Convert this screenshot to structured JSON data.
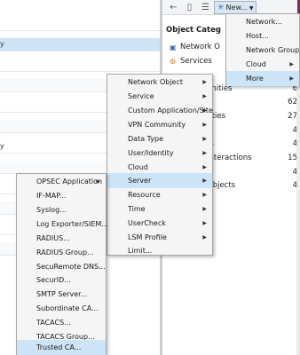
{
  "left_table": {
    "rows": [
      {
        "text": "",
        "selected": false
      },
      {
        "text": "y",
        "selected": true
      },
      {
        "text": "",
        "selected": false
      },
      {
        "text": "",
        "selected": false
      },
      {
        "text": "",
        "selected": false
      },
      {
        "text": "",
        "selected": false
      },
      {
        "text": "y",
        "selected": false
      },
      {
        "text": "",
        "selected": false
      },
      {
        "text": "",
        "selected": false
      },
      {
        "text": "",
        "selected": false
      },
      {
        "text": "",
        "selected": false
      },
      {
        "text": "",
        "selected": false
      }
    ]
  },
  "toolbar": {
    "new_label": "New...",
    "icons": [
      "back-arrow-icon",
      "list-view-icon",
      "new-star-icon"
    ]
  },
  "panel": {
    "title": "Object Categ",
    "categories": [
      {
        "label": "Network O",
        "icon": "network-icon"
      },
      {
        "label": "Services",
        "icon": "services-icon"
      }
    ],
    "counts": [
      {
        "label": "unities",
        "value": "6"
      },
      {
        "label": "",
        "value": "62"
      },
      {
        "label": "tities",
        "value": "27"
      },
      {
        "label": "",
        "value": "4"
      },
      {
        "label": "ts",
        "value": "4"
      },
      {
        "label": "Interactions",
        "value": "15"
      },
      {
        "label": "",
        "value": "4"
      },
      {
        "label": "Objects",
        "value": "4"
      }
    ]
  },
  "menu_new": {
    "items": [
      {
        "label": "Network...",
        "submenu": false,
        "highlighted": false
      },
      {
        "label": "Host...",
        "submenu": false,
        "highlighted": false
      },
      {
        "label": "Network Group...",
        "submenu": false,
        "highlighted": false
      },
      {
        "label": "Cloud",
        "submenu": true,
        "highlighted": false
      },
      {
        "label": "More",
        "submenu": true,
        "highlighted": true
      }
    ]
  },
  "menu_more": {
    "items": [
      {
        "label": "Network Object",
        "submenu": true,
        "highlighted": false
      },
      {
        "label": "Service",
        "submenu": true,
        "highlighted": false
      },
      {
        "label": "Custom Application/Site",
        "submenu": true,
        "highlighted": false
      },
      {
        "label": "VPN Community",
        "submenu": true,
        "highlighted": false
      },
      {
        "label": "Data Type",
        "submenu": true,
        "highlighted": false
      },
      {
        "label": "User/Identity",
        "submenu": true,
        "highlighted": false
      },
      {
        "label": "Cloud",
        "submenu": true,
        "highlighted": false
      },
      {
        "label": "Server",
        "submenu": true,
        "highlighted": true
      },
      {
        "label": "Resource",
        "submenu": true,
        "highlighted": false
      },
      {
        "label": "Time",
        "submenu": true,
        "highlighted": false
      },
      {
        "label": "UserCheck",
        "submenu": true,
        "highlighted": false
      },
      {
        "label": "LSM Profile",
        "submenu": true,
        "highlighted": false
      },
      {
        "label": "Limit...",
        "submenu": false,
        "highlighted": false
      }
    ]
  },
  "menu_server": {
    "items": [
      {
        "label": "OPSEC Application",
        "submenu": true,
        "highlighted": false
      },
      {
        "label": "IF-MAP...",
        "submenu": false,
        "highlighted": false
      },
      {
        "label": "Syslog...",
        "submenu": false,
        "highlighted": false
      },
      {
        "label": "Log Exporter/SIEM...",
        "submenu": false,
        "highlighted": false
      },
      {
        "label": "RADIUS...",
        "submenu": false,
        "highlighted": false
      },
      {
        "label": "RADIUS Group...",
        "submenu": false,
        "highlighted": false
      },
      {
        "label": "SecuRemote DNS...",
        "submenu": false,
        "highlighted": false
      },
      {
        "label": "SecurID...",
        "submenu": false,
        "highlighted": false
      },
      {
        "label": "SMTP Server...",
        "submenu": false,
        "highlighted": false
      },
      {
        "label": "Subordinate CA...",
        "submenu": false,
        "highlighted": false
      },
      {
        "label": "TACACS...",
        "submenu": false,
        "highlighted": false
      },
      {
        "label": "TACACS Group...",
        "submenu": false,
        "highlighted": false
      },
      {
        "label": "Trusted CA...",
        "submenu": false,
        "highlighted": true
      }
    ]
  },
  "colors": {
    "highlight": "#cce4f7",
    "row_selected": "#cde3f6",
    "menu_bg": "#f5f5f5",
    "accent_edge": "#7b2a62"
  }
}
